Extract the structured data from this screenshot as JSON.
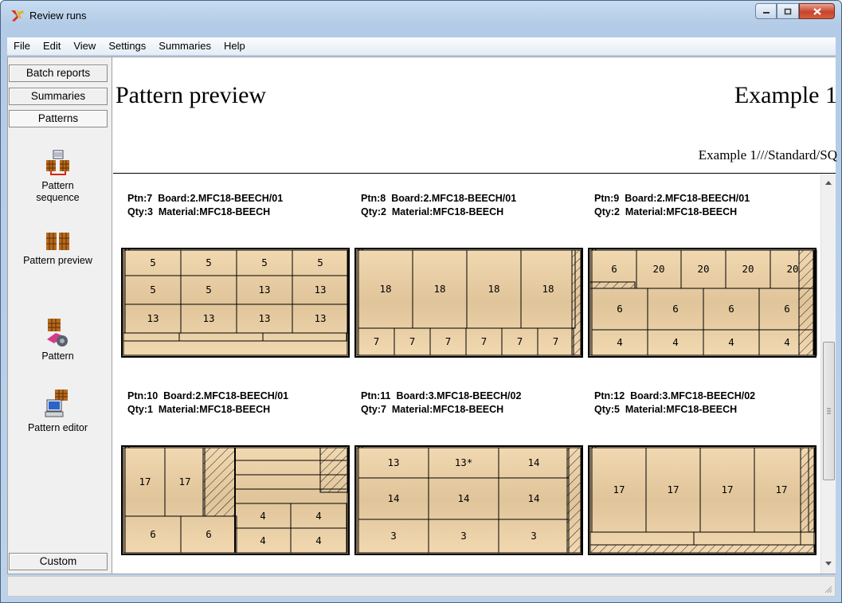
{
  "window": {
    "title": "Review runs"
  },
  "menu": [
    "File",
    "Edit",
    "View",
    "Settings",
    "Summaries",
    "Help"
  ],
  "left_tabs": {
    "batch_reports": "Batch reports",
    "summaries": "Summaries",
    "patterns": "Patterns",
    "custom": "Custom"
  },
  "left_items": {
    "sequence": [
      "Pattern",
      "sequence"
    ],
    "preview": "Pattern preview",
    "pattern": "Pattern",
    "editor": "Pattern editor"
  },
  "header": {
    "title": "Pattern preview",
    "example": "Example 1",
    "path": "Example 1///Standard/SQ"
  },
  "patterns": [
    {
      "line1": "Ptn:7  Board:2.MFC18-BEECH/01",
      "line2": "Qty:3  Material:MFC18-BEECH",
      "parts": [
        [
          "5",
          "5",
          "5",
          "5"
        ],
        [
          "5",
          "5",
          "13",
          "13"
        ],
        [
          "13",
          "13",
          "13",
          "13"
        ]
      ]
    },
    {
      "line1": "Ptn:8  Board:2.MFC18-BEECH/01",
      "line2": "Qty:2  Material:MFC18-BEECH",
      "parts": [
        [
          "18",
          "18",
          "18",
          "18"
        ],
        [
          "7",
          "7",
          "7",
          "7",
          "7",
          "7"
        ]
      ]
    },
    {
      "line1": "Ptn:9  Board:2.MFC18-BEECH/01",
      "line2": "Qty:2  Material:MFC18-BEECH",
      "parts": [
        [
          "6",
          "20",
          "20",
          "20",
          "20"
        ],
        [
          "6",
          "6",
          "6",
          "6"
        ],
        [
          "4",
          "4",
          "4",
          "4"
        ]
      ]
    },
    {
      "line1": "Ptn:10  Board:2.MFC18-BEECH/01",
      "line2": "Qty:1  Material:MFC18-BEECH",
      "parts": [
        [
          "17",
          "17"
        ],
        [
          "6",
          "6"
        ],
        [
          "4",
          "4"
        ],
        [
          "4",
          "4"
        ]
      ]
    },
    {
      "line1": "Ptn:11  Board:3.MFC18-BEECH/02",
      "line2": "Qty:7  Material:MFC18-BEECH",
      "parts": [
        [
          "13",
          "13*",
          "14"
        ],
        [
          "14",
          "14",
          "14"
        ],
        [
          "3",
          "3",
          "3"
        ]
      ]
    },
    {
      "line1": "Ptn:12  Board:3.MFC18-BEECH/02",
      "line2": "Qty:5  Material:MFC18-BEECH",
      "parts": [
        [
          "17",
          "17",
          "17",
          "17"
        ]
      ]
    }
  ],
  "colors": {
    "wood": "#f2d9b1",
    "wood_grain": "#e0c49a",
    "title_bar": "#bcd2eb",
    "close": "#c8442b"
  }
}
